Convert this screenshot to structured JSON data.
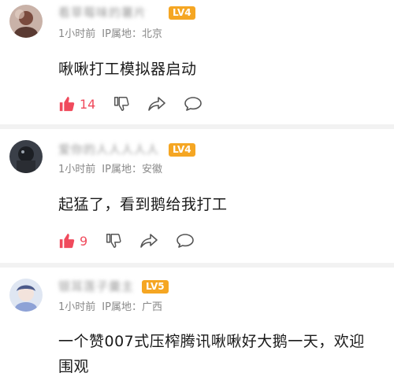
{
  "comments": [
    {
      "username": "看草莓味的薯片",
      "level": "LV4",
      "level_color": "#f5a623",
      "time": "1小时前",
      "ip_label": "IP属地：北京",
      "content": "啾啾打工模拟器启动",
      "likes": "14"
    },
    {
      "username": "爱你的人人人人人",
      "level": "LV4",
      "level_color": "#f5a623",
      "time": "1小时前",
      "ip_label": "IP属地：安徽",
      "content": "起猛了，看到鹅给我打工",
      "likes": "9"
    },
    {
      "username": "银耳莲子羹主",
      "level": "LV5",
      "level_color": "#f5a623",
      "time": "1小时前",
      "ip_label": "IP属地：广西",
      "content": "一个赞007式压榨腾讯啾啾好大鹅一天，欢迎围观"
    }
  ],
  "colors": {
    "accent": "#f04a5c",
    "meta": "#888888",
    "badge": "#f5a623"
  },
  "icons": [
    "thumbs-up-icon",
    "thumbs-down-icon",
    "share-icon",
    "comment-icon"
  ]
}
